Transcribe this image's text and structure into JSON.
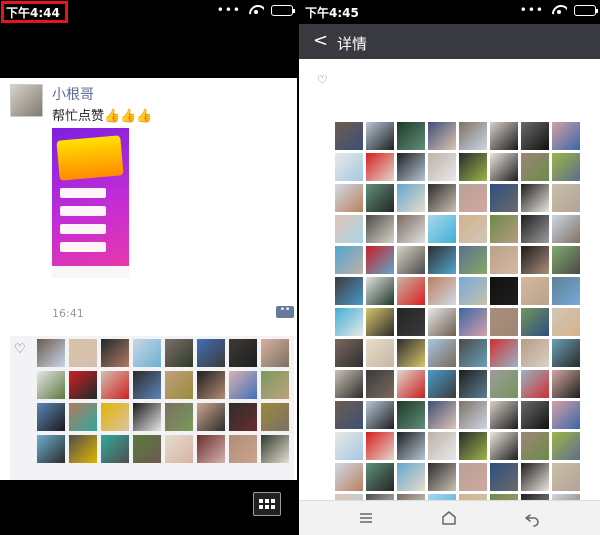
{
  "left": {
    "status_time": "下午4:44",
    "user_name": "小根哥",
    "post_text": "帮忙点赞👍👍👍",
    "post_time": "16:41"
  },
  "right": {
    "status_time": "下午4:45",
    "nav_title": "详情"
  },
  "icons": [
    "signal-dots-icon",
    "wifi-icon",
    "battery-icon",
    "heart-icon",
    "comment-icon",
    "grid-icon",
    "back-chevron-icon",
    "menu-icon",
    "home-icon",
    "back-icon"
  ],
  "colors": {
    "highlight_red": "#e4161b",
    "wechat_link_blue": "#586b95",
    "navbar_dark": "#393a3f"
  },
  "likes_grid": {
    "left_palette": [
      "#6b5a4f",
      "#d9c3a8",
      "#1e2a2f",
      "#c8d6e8",
      "#7c6f68",
      "#3f70b8",
      "#3d3935",
      "#d8b29f",
      "#e6e6e6",
      "#cf1f1f",
      "#d4c0b0",
      "#2a2a2a",
      "#bfa17f",
      "#1f1f1f",
      "#d6b3b0",
      "#7a9a5c",
      "#5d86b8",
      "#b07a62",
      "#e2b400",
      "#1a1a1a",
      "#7a6f5f",
      "#caa58e",
      "#2d2d2d",
      "#9a8a3a",
      "#6bb0cf",
      "#4f4f4f",
      "#31a89b",
      "#5b7a3f",
      "#e4ddd2",
      "#6a2d2d",
      "#b28c76",
      "#2f3b2a"
    ],
    "right_palette": [
      "#6d5d4f",
      "#b6c6d8",
      "#203828",
      "#3c4f77",
      "#7f7265",
      "#d8d0c8",
      "#6a6a6a",
      "#d4a0a8",
      "#e8e8e8",
      "#d91e1e",
      "#1f1f1f",
      "#bcb2a8",
      "#2a2a2a",
      "#ece7de",
      "#9d8676",
      "#9cb54a",
      "#cfdbe8",
      "#5f8f7a",
      "#61a6cf",
      "#2c2c2c",
      "#b7a197",
      "#2d4f7f",
      "#1d1d1d",
      "#c6c1a8",
      "#e0c4b2",
      "#4c4c4c",
      "#7b6a5f",
      "#a8d6ee",
      "#d3b28b",
      "#6a8b4a",
      "#1e1e1e",
      "#ccd7e5",
      "#52a5cf",
      "#c81f1f",
      "#d9d1c4",
      "#2e2e2e",
      "#5f6e8a",
      "#b8a28a",
      "#1c1c1c",
      "#82aa6a",
      "#3b3b3b",
      "#e1e1e1",
      "#c9b5a6",
      "#bb7f5c",
      "#77a9d9",
      "#111111",
      "#d8b7a0",
      "#5d7f95",
      "#40b0d5",
      "#d6c66a",
      "#252525",
      "#e8e8e8",
      "#3a67a5",
      "#aa8e7a",
      "#74945b",
      "#d2c6b8",
      "#7b685e",
      "#e7ddc8",
      "#2b2b2b",
      "#a6c8df",
      "#4a4a4a",
      "#cf2f2f",
      "#b89b82",
      "#68a0b6",
      "#cbc0b4",
      "#3a3a3a",
      "#e0d8cc",
      "#4a9aca",
      "#1e1e1e",
      "#9d9d9d",
      "#98b4c7",
      "#d3a7a1"
    ]
  }
}
